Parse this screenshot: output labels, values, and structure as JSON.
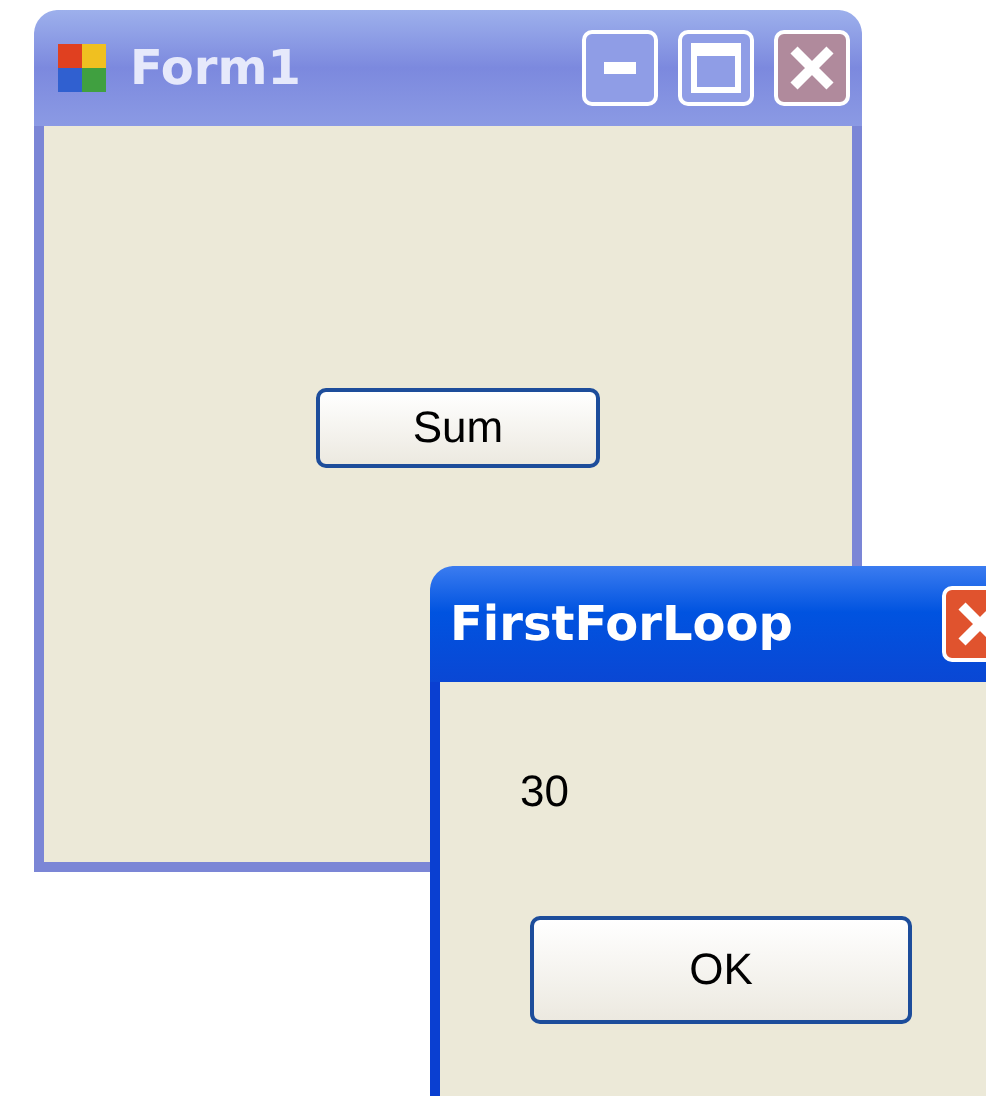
{
  "form": {
    "title": "Form1",
    "active": false,
    "button": "Sum"
  },
  "message_box": {
    "title": "FirstForLoop",
    "active": true,
    "message": "30",
    "button": "OK"
  }
}
